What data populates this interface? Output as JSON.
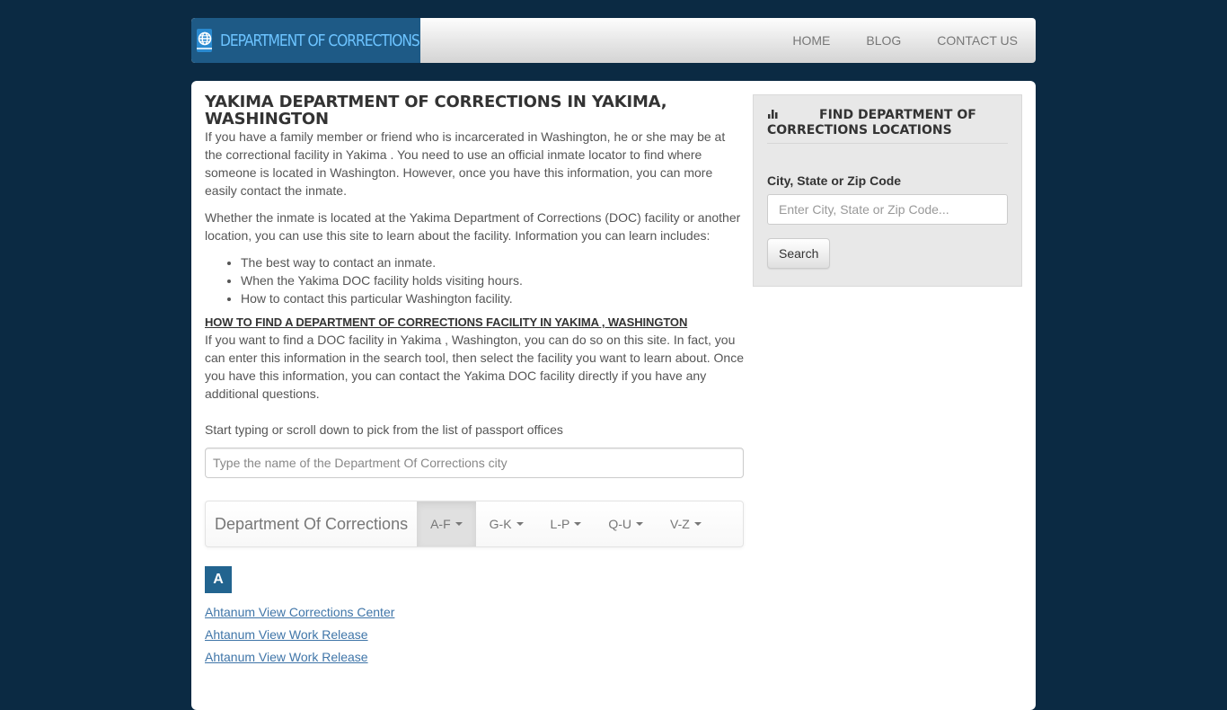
{
  "navbar": {
    "brand_icon": "passport-globe-icon",
    "brand_text": "DEPARTMENT OF CORRECTIONS",
    "links": [
      {
        "label": "HOME"
      },
      {
        "label": "BLOG"
      },
      {
        "label": "CONTACT US"
      }
    ]
  },
  "main": {
    "title": "YAKIMA DEPARTMENT OF CORRECTIONS IN YAKIMA, WASHINGTON",
    "para1": "If you have a family member or friend who is incarcerated in Washington, he or she may be at the correctional facility in Yakima . You need to use an official inmate locator to find where someone is located in Washington. However, once you have this information, you can more easily contact the inmate.",
    "para2": "Whether the inmate is located at the Yakima Department of Corrections (DOC) facility or another location, you can use this site to learn about the facility. Information you can learn includes:",
    "bullets": [
      "The best way to contact an inmate.",
      "When the Yakima DOC facility holds visiting hours.",
      "How to contact this particular Washington facility."
    ],
    "subheading": "HOW TO FIND A DEPARTMENT OF CORRECTIONS FACILITY IN YAKIMA , WASHINGTON",
    "para3": "If you want to find a DOC facility in Yakima , Washington, you can do so on this site. In fact, you can enter this information in the search tool, then select the facility you want to learn about. Once you have this information, you can contact the Yakima DOC facility directly if you have any additional questions.",
    "pick_label": "Start typing or scroll down to pick from the list of passport offices",
    "city_input": {
      "value": "",
      "placeholder": "Type the name of the Department Of Corrections city"
    },
    "alpha_nav": {
      "brand": "Department Of Corrections",
      "tabs": [
        {
          "label": "A-F",
          "active": true
        },
        {
          "label": "G-K",
          "active": false
        },
        {
          "label": "L-P",
          "active": false
        },
        {
          "label": "Q-U",
          "active": false
        },
        {
          "label": "V-Z",
          "active": false
        }
      ]
    },
    "letter": "A",
    "facilities": [
      "Ahtanum View Corrections Center",
      "Ahtanum View Work Release",
      "Ahtanum View Work Release"
    ]
  },
  "sidebar": {
    "icon": "bar-chart-icon",
    "title": "FIND DEPARTMENT OF CORRECTIONS LOCATIONS",
    "field_label": "City, State or Zip Code",
    "input": {
      "value": "",
      "placeholder": "Enter City, State or Zip Code..."
    },
    "search_label": "Search"
  },
  "colors": {
    "page_bg": "#0b2a43",
    "brand_bg": "#1e5a86",
    "brand_text": "#6cc3ff",
    "letter_badge": "#22648f",
    "link": "#3f75a8"
  }
}
